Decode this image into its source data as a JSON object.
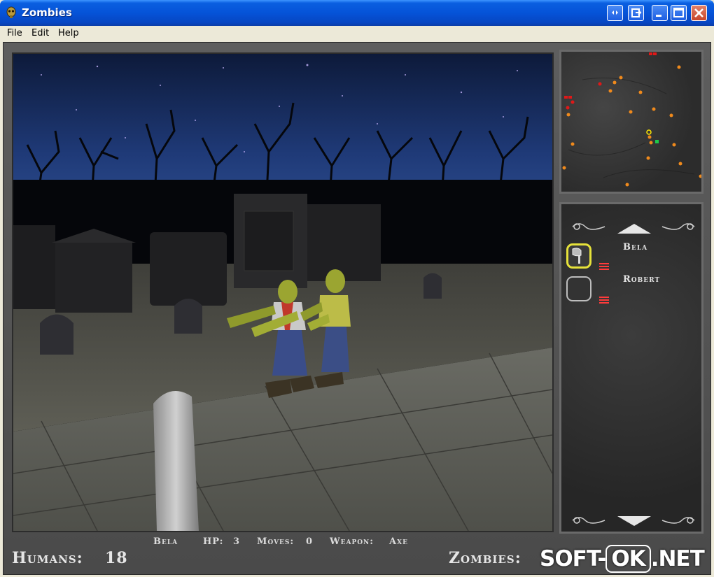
{
  "window": {
    "title": "Zombies",
    "controls": [
      "collapse-icon",
      "export-icon",
      "minimize-icon",
      "maximize-icon",
      "close-icon"
    ]
  },
  "menu": {
    "file": "File",
    "edit": "Edit",
    "help": "Help"
  },
  "party": {
    "members": [
      {
        "name": "Bela",
        "slot_item": "axe-icon",
        "selected": true
      },
      {
        "name": "Robert",
        "slot_item": "",
        "selected": false
      }
    ]
  },
  "status": {
    "character": "Bela",
    "hp_label": "HP:",
    "hp_value": "3",
    "moves_label": "Moves:",
    "moves_value": "0",
    "weapon_label": "Weapon:",
    "weapon_value": "Axe"
  },
  "counts": {
    "humans_label": "Humans:",
    "humans_value": "18",
    "zombies_label": "Zombies:"
  },
  "watermark": {
    "part1": "SOFT-",
    "part2": "OK",
    "part3": ".NET"
  },
  "colors": {
    "selected_slot": "#e6e23a",
    "health_bars": "#ff3b3b",
    "minimap_zombie": "#f08a1c",
    "minimap_human": "#e01818"
  }
}
